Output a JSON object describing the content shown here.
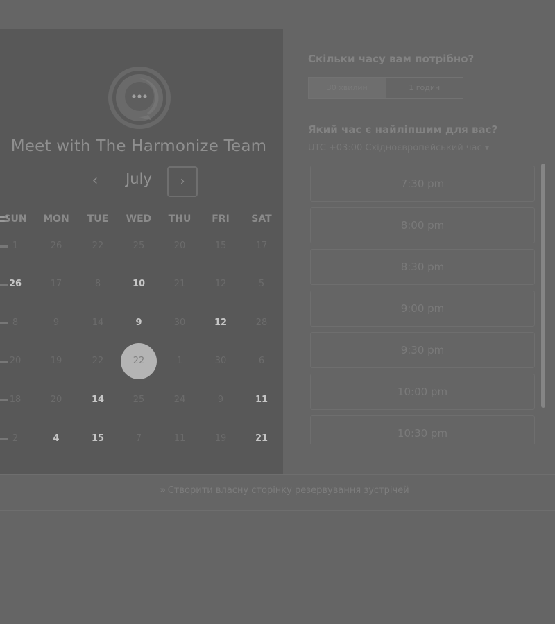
{
  "header": {
    "title": "Meet with The Harmonize Team"
  },
  "logo": {
    "icon": "chat-bubble-logo"
  },
  "calendar": {
    "month": "July",
    "prev_icon": "‹",
    "next_icon": "›",
    "weekdays": [
      "SUN",
      "MON",
      "TUE",
      "WED",
      "THU",
      "FRI",
      "SAT"
    ],
    "weeks": [
      [
        {
          "d": "1",
          "on": false
        },
        {
          "d": "26",
          "on": false
        },
        {
          "d": "22",
          "on": false
        },
        {
          "d": "25",
          "on": false
        },
        {
          "d": "20",
          "on": false
        },
        {
          "d": "15",
          "on": false
        },
        {
          "d": "17",
          "on": false
        }
      ],
      [
        {
          "d": "26",
          "on": true
        },
        {
          "d": "17",
          "on": false
        },
        {
          "d": "8",
          "on": false
        },
        {
          "d": "10",
          "on": true
        },
        {
          "d": "21",
          "on": false
        },
        {
          "d": "12",
          "on": false
        },
        {
          "d": "5",
          "on": false
        }
      ],
      [
        {
          "d": "8",
          "on": false
        },
        {
          "d": "9",
          "on": false
        },
        {
          "d": "14",
          "on": false
        },
        {
          "d": "9",
          "on": true
        },
        {
          "d": "30",
          "on": false
        },
        {
          "d": "12",
          "on": true
        },
        {
          "d": "28",
          "on": false
        }
      ],
      [
        {
          "d": "20",
          "on": false
        },
        {
          "d": "19",
          "on": false
        },
        {
          "d": "22",
          "on": false
        },
        {
          "d": "22",
          "on": false,
          "selected": true
        },
        {
          "d": "1",
          "on": false
        },
        {
          "d": "30",
          "on": false
        },
        {
          "d": "6",
          "on": false
        }
      ],
      [
        {
          "d": "18",
          "on": false
        },
        {
          "d": "20",
          "on": false
        },
        {
          "d": "14",
          "on": true
        },
        {
          "d": "25",
          "on": false
        },
        {
          "d": "24",
          "on": false
        },
        {
          "d": "9",
          "on": false
        },
        {
          "d": "11",
          "on": true
        }
      ],
      [
        {
          "d": "2",
          "on": false
        },
        {
          "d": "4",
          "on": true
        },
        {
          "d": "15",
          "on": true
        },
        {
          "d": "7",
          "on": false
        },
        {
          "d": "11",
          "on": false
        },
        {
          "d": "19",
          "on": false
        },
        {
          "d": "21",
          "on": true
        }
      ]
    ]
  },
  "booking": {
    "duration_question": "Скільки часу вам потрібно?",
    "durations": [
      "30 хвилин",
      "1 годин"
    ],
    "time_question": "Який час є найліпшим для вас?",
    "timezone": "UTC +03:00 Східноєвропейський час ▾",
    "slots": [
      "7:30 pm",
      "8:00 pm",
      "8:30 pm",
      "9:00 pm",
      "9:30 pm",
      "10:00 pm",
      "10:30 pm"
    ]
  },
  "footer": {
    "link_icon": "»",
    "link_text": "Створити власну сторінку резервування зустрічей"
  }
}
